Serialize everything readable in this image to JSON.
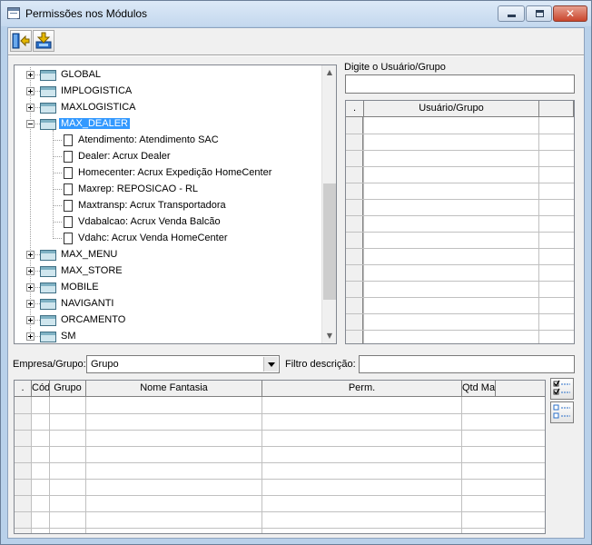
{
  "window": {
    "title": "Permissões nos Módulos"
  },
  "toolbar": {
    "buttons": [
      {
        "name": "exit-button",
        "icon": "exit-door-icon"
      },
      {
        "name": "save-button",
        "icon": "save-download-icon"
      }
    ]
  },
  "tree": {
    "items": [
      {
        "label": "GLOBAL",
        "type": "folder",
        "expanded": false
      },
      {
        "label": "IMPLOGISTICA",
        "type": "folder",
        "expanded": false
      },
      {
        "label": "MAXLOGISTICA",
        "type": "folder",
        "expanded": false
      },
      {
        "label": "MAX_DEALER",
        "type": "folder",
        "expanded": true,
        "selected": true
      },
      {
        "label": "Atendimento: Atendimento SAC",
        "type": "doc"
      },
      {
        "label": "Dealer: Acrux Dealer",
        "type": "doc"
      },
      {
        "label": "Homecenter: Acrux Expedição HomeCenter",
        "type": "doc"
      },
      {
        "label": "Maxrep: REPOSICAO  - RL",
        "type": "doc"
      },
      {
        "label": "Maxtransp: Acrux Transportadora",
        "type": "doc"
      },
      {
        "label": "Vdabalcao: Acrux Venda Balcão",
        "type": "doc"
      },
      {
        "label": "Vdahc: Acrux Venda HomeCenter",
        "type": "doc"
      },
      {
        "label": "MAX_MENU",
        "type": "folder",
        "expanded": false
      },
      {
        "label": "MAX_STORE",
        "type": "folder",
        "expanded": false
      },
      {
        "label": "MOBILE",
        "type": "folder",
        "expanded": false
      },
      {
        "label": "NAVIGANTI",
        "type": "folder",
        "expanded": false
      },
      {
        "label": "ORCAMENTO",
        "type": "folder",
        "expanded": false
      },
      {
        "label": "SM",
        "type": "folder",
        "expanded": false
      }
    ]
  },
  "user_search": {
    "label": "Digite o Usuário/Grupo",
    "value": ""
  },
  "user_grid": {
    "columns": [
      ".",
      "Usuário/Grupo",
      ""
    ],
    "rows": []
  },
  "filters": {
    "empresa_label": "Empresa/Grupo:",
    "empresa_value": "Grupo",
    "descricao_label": "Filtro descrição:",
    "descricao_value": ""
  },
  "perm_grid": {
    "columns": [
      ".",
      "Código",
      "Grupo",
      "Nome Fantasia",
      "Perm.",
      "Qtd Max Inst"
    ],
    "rows": []
  },
  "side_buttons": [
    {
      "name": "check-all-button",
      "icon": "checklist-icon"
    },
    {
      "name": "uncheck-all-button",
      "icon": "unchecked-list-icon"
    }
  ],
  "colors": {
    "selection": "#3399ff",
    "window_frame": "#b9d1ea",
    "face": "#f0f0f0"
  }
}
